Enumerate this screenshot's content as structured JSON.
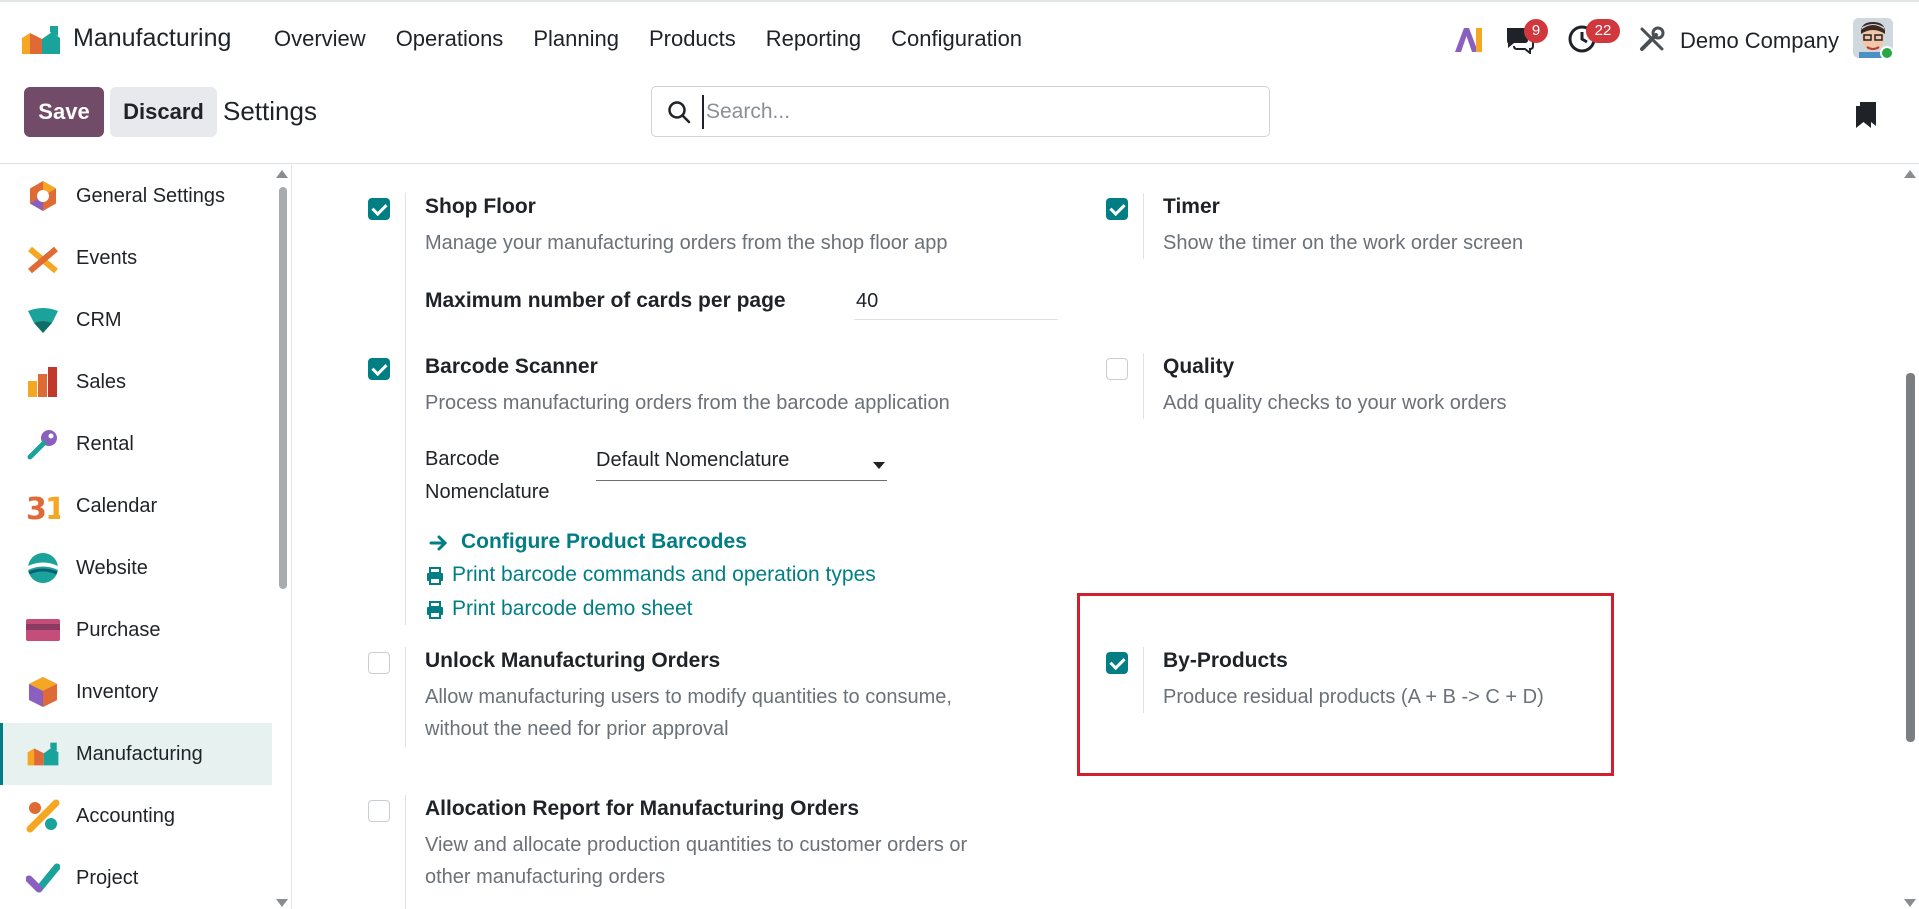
{
  "navbar": {
    "app_name": "Manufacturing",
    "menu": [
      "Overview",
      "Operations",
      "Planning",
      "Products",
      "Reporting",
      "Configuration"
    ],
    "messages_count": "9",
    "activities_count": "22",
    "company": "Demo Company"
  },
  "controls": {
    "save_label": "Save",
    "discard_label": "Discard",
    "title": "Settings",
    "search_placeholder": "Search..."
  },
  "sidebar": {
    "items": [
      {
        "label": "General Settings",
        "icon": "general-settings-icon"
      },
      {
        "label": "Events",
        "icon": "events-icon"
      },
      {
        "label": "CRM",
        "icon": "crm-icon"
      },
      {
        "label": "Sales",
        "icon": "sales-icon"
      },
      {
        "label": "Rental",
        "icon": "rental-icon"
      },
      {
        "label": "Calendar",
        "icon": "calendar-icon"
      },
      {
        "label": "Website",
        "icon": "website-icon"
      },
      {
        "label": "Purchase",
        "icon": "purchase-icon"
      },
      {
        "label": "Inventory",
        "icon": "inventory-icon"
      },
      {
        "label": "Manufacturing",
        "icon": "manufacturing-icon"
      },
      {
        "label": "Accounting",
        "icon": "accounting-icon"
      },
      {
        "label": "Project",
        "icon": "project-icon"
      }
    ],
    "active": "Manufacturing"
  },
  "settings": {
    "shop_floor": {
      "title": "Shop Floor",
      "desc": "Manage your manufacturing orders from the shop floor app",
      "checked": true,
      "max_cards_label": "Maximum number of cards per page",
      "max_cards_value": "40"
    },
    "timer": {
      "title": "Timer",
      "desc": "Show the timer on the work order screen",
      "checked": true
    },
    "barcode_scanner": {
      "title": "Barcode Scanner",
      "desc": "Process manufacturing orders from the barcode application",
      "checked": true,
      "nomenclature_label_1": "Barcode",
      "nomenclature_label_2": "Nomenclature",
      "nomenclature_value": "Default Nomenclature",
      "link_configure": "Configure Product Barcodes",
      "link_print_commands": "Print barcode commands and operation types",
      "link_print_demo": "Print barcode demo sheet"
    },
    "quality": {
      "title": "Quality",
      "desc": "Add quality checks to your work orders",
      "checked": false
    },
    "unlock_mo": {
      "title": "Unlock Manufacturing Orders",
      "desc_1": "Allow manufacturing users to modify quantities to consume,",
      "desc_2": "without the need for prior approval",
      "checked": false
    },
    "by_products": {
      "title": "By-Products",
      "desc": "Produce residual products (A + B -> C + D)",
      "checked": true
    },
    "allocation_report": {
      "title": "Allocation Report for Manufacturing Orders",
      "desc_1": "View and allocate production quantities to customer orders or",
      "desc_2": "other manufacturing orders",
      "checked": false
    }
  },
  "colors": {
    "brand": "#714b67",
    "accent": "#017e84",
    "highlight": "#d0202d",
    "badge": "#d0383e"
  }
}
